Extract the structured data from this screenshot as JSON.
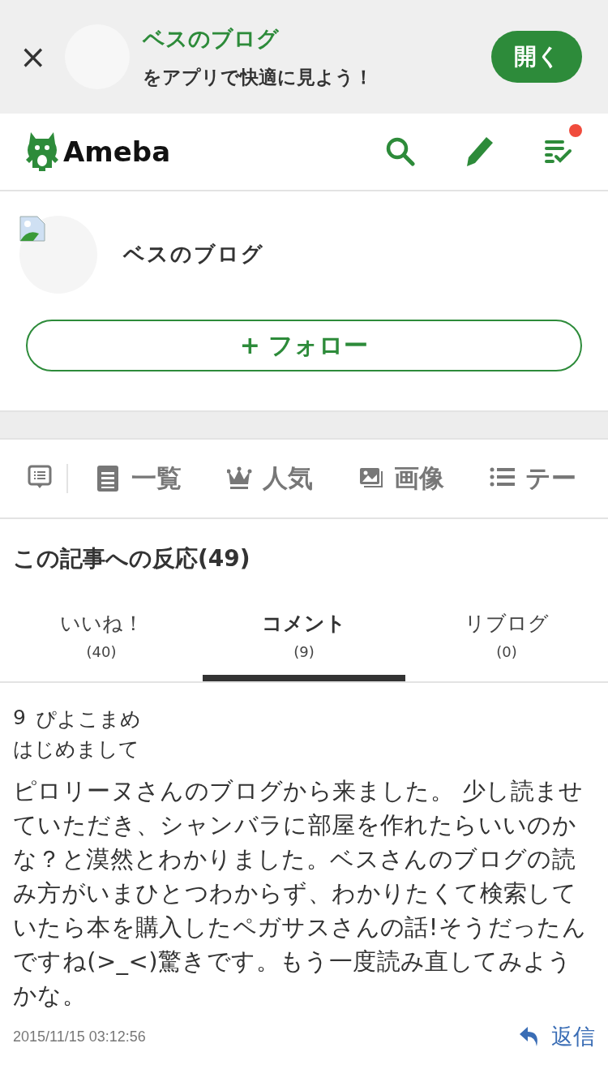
{
  "app_banner": {
    "close": "×",
    "blog_name": "ベスのブログ",
    "message": "をアプリで快適に見よう！",
    "open_button": "開く"
  },
  "header": {
    "logo": "Ameba",
    "notification": true
  },
  "profile": {
    "blog_title": "ベスのブログ",
    "follow_button": "+ フォロー"
  },
  "nav": [
    {
      "kind": "comment"
    },
    {
      "kind": "list",
      "label": "一覧"
    },
    {
      "kind": "crown",
      "label": "人気"
    },
    {
      "kind": "image",
      "label": "画像"
    },
    {
      "kind": "theme",
      "label": "テー"
    }
  ],
  "reactions": {
    "title": "この記事への反応(49)",
    "tabs": [
      {
        "label": "いいね！",
        "count": "(40)",
        "selected": false
      },
      {
        "label": "コメント",
        "count": "(9)",
        "selected": true
      },
      {
        "label": "リブログ",
        "count": "(0)",
        "selected": false
      }
    ]
  },
  "comment": {
    "number": "9",
    "author": "ぴよこまめ",
    "subject": "はじめまして",
    "body": "ピロリーヌさんのブログから来ました。 少し読ませていただき、シャンバラに部屋を作れたらいいのかな？と漠然とわかりました。ベスさんのブログの読み方がいまひとつわからず、わかりたくて検索していたら本を購入したペガサスさんの話!そうだったんですね(>_<)驚きです。もう一度読み直してみようかな。",
    "date": "2015/11/15 03:12:56",
    "reply": "返信"
  }
}
